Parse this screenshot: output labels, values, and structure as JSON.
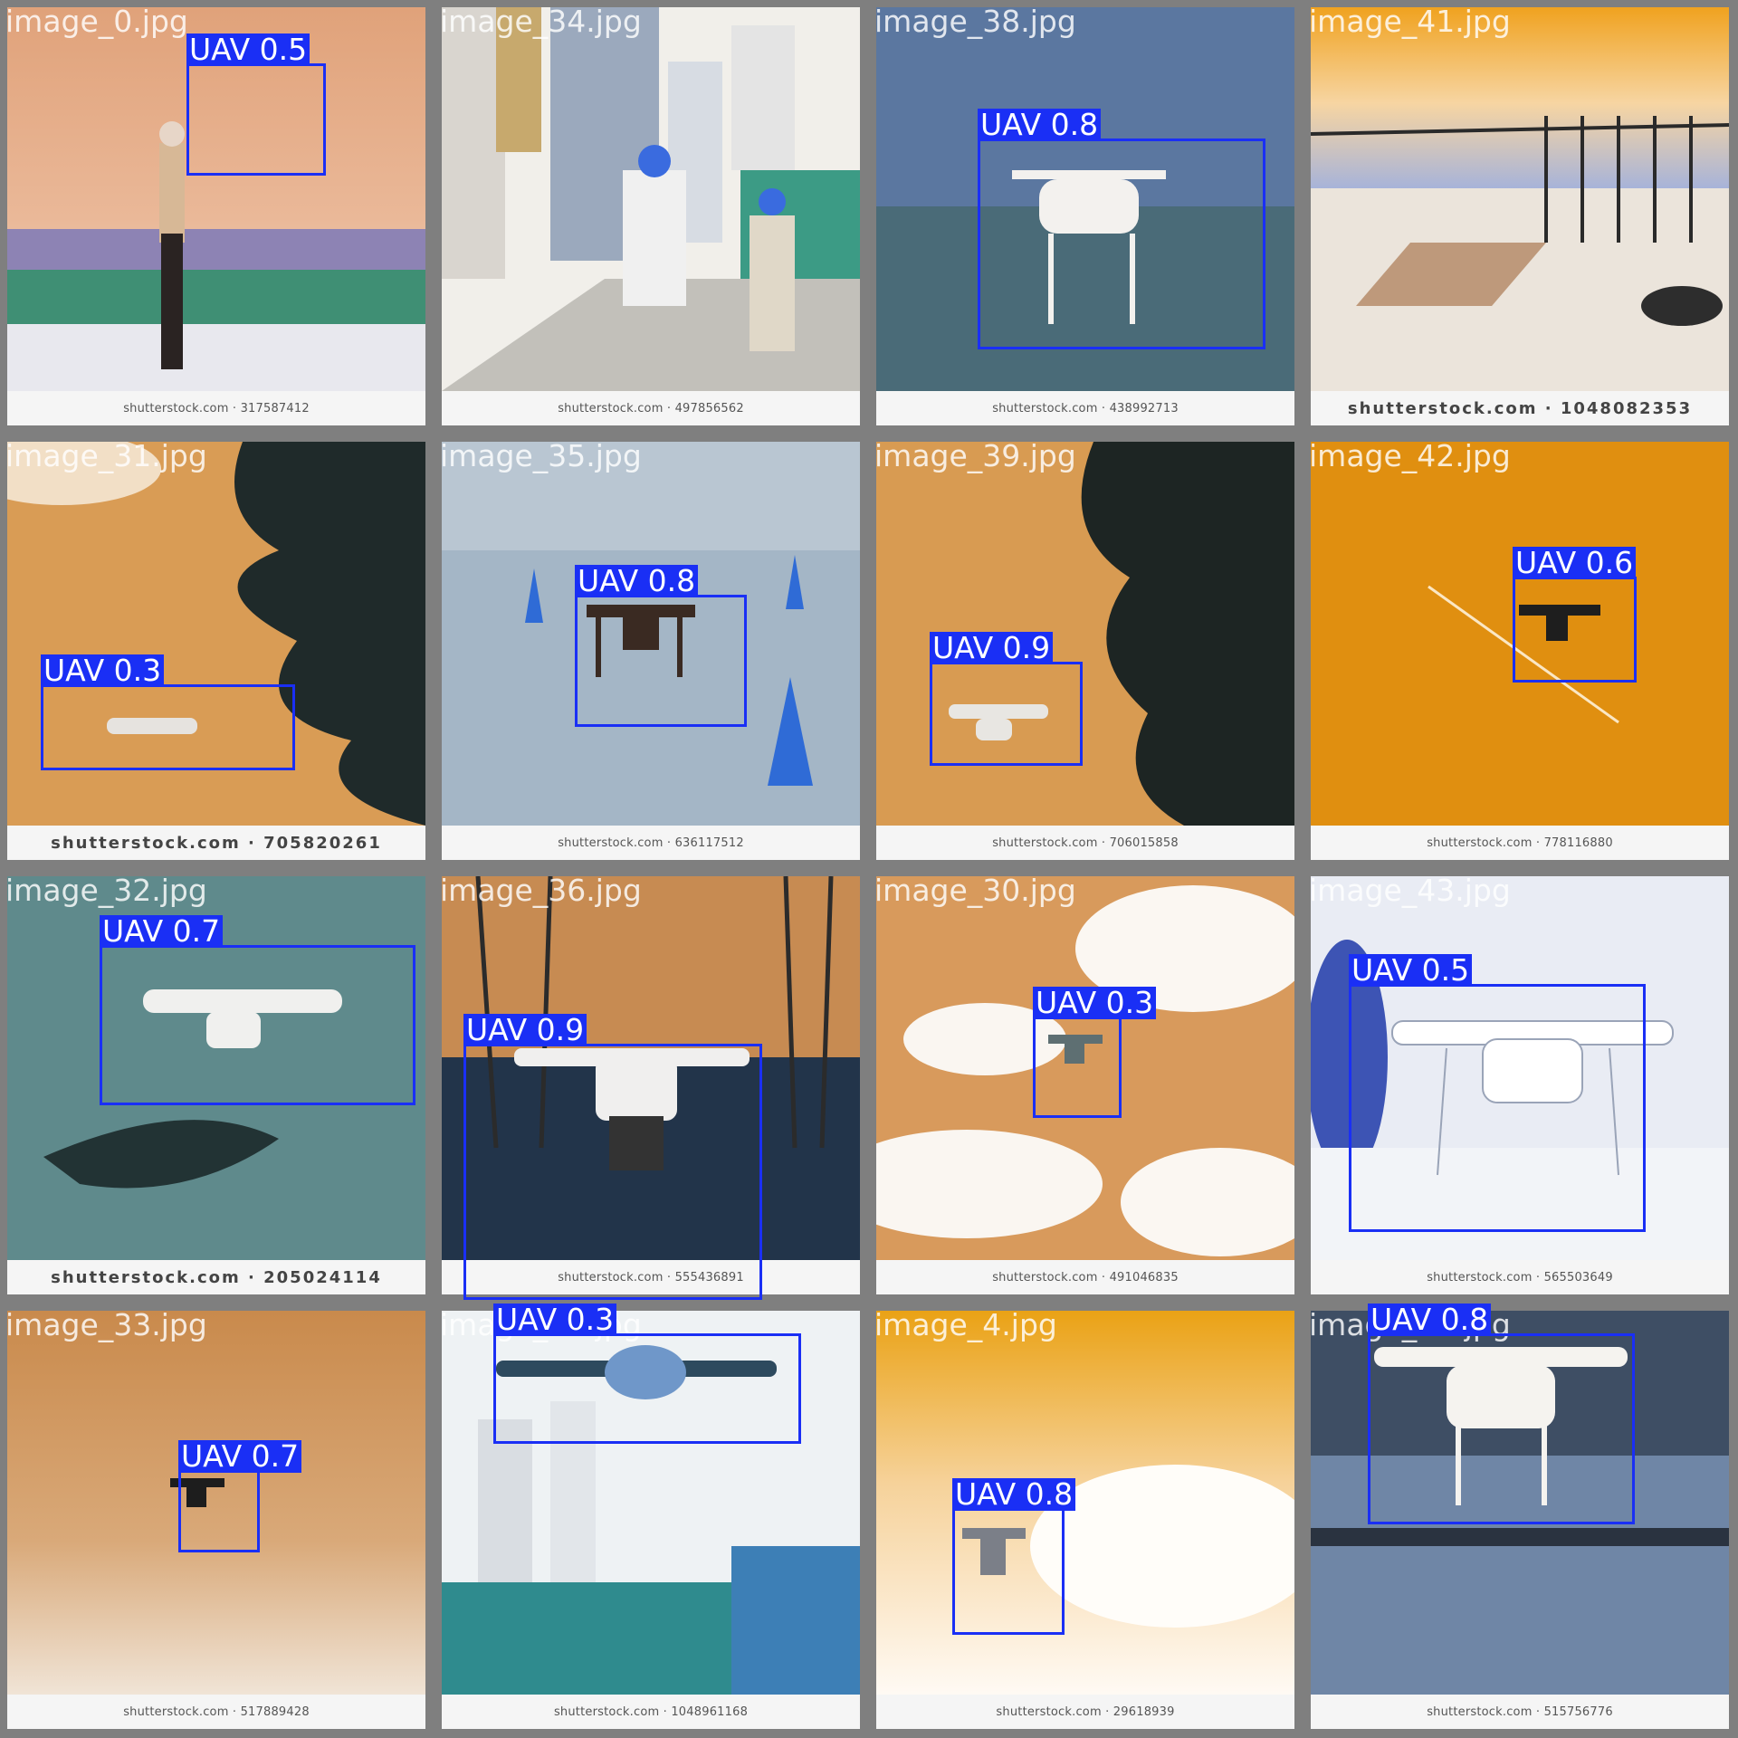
{
  "colors": {
    "box": "#1a2ff5",
    "grid_bg": "#7f7f7f"
  },
  "tiles": [
    {
      "filename": "image_0.jpg",
      "watermark": "shutterstock.com · 317587412",
      "det": "UAV 0.5"
    },
    {
      "filename": "image_34.jpg",
      "watermark": "shutterstock.com · 497856562",
      "det": ""
    },
    {
      "filename": "image_38.jpg",
      "watermark": "shutterstock.com · 438992713",
      "det": "UAV 0.8"
    },
    {
      "filename": "image_41.jpg",
      "watermark": "shutterstock.com · 1048082353",
      "det": ""
    },
    {
      "filename": "image_31.jpg",
      "watermark": "shutterstock.com · 705820261",
      "det": "UAV 0.3"
    },
    {
      "filename": "image_35.jpg",
      "watermark": "shutterstock.com · 636117512",
      "det": "UAV 0.8"
    },
    {
      "filename": "image_39.jpg",
      "watermark": "shutterstock.com · 706015858",
      "det": "UAV 0.9"
    },
    {
      "filename": "image_42.jpg",
      "watermark": "shutterstock.com · 778116880",
      "det": "UAV 0.6"
    },
    {
      "filename": "image_32.jpg",
      "watermark": "shutterstock.com · 205024114",
      "det": "UAV 0.7"
    },
    {
      "filename": "image_36.jpg",
      "watermark": "shutterstock.com · 555436891",
      "det": "UAV 0.9"
    },
    {
      "filename": "image_30.jpg",
      "watermark": "shutterstock.com · 491046835",
      "det": "UAV 0.3"
    },
    {
      "filename": "image_43.jpg",
      "watermark": "shutterstock.com · 565503649",
      "det": "UAV 0.5"
    },
    {
      "filename": "image_33.jpg",
      "watermark": "shutterstock.com · 517889428",
      "det": "UAV 0.7"
    },
    {
      "filename": "image_37.jpg",
      "watermark": "shutterstock.com · 1048961168",
      "det": "UAV 0.3"
    },
    {
      "filename": "image_4.jpg",
      "watermark": "shutterstock.com · 29618939",
      "det": "UAV 0.8"
    },
    {
      "filename": "image_44.jpg",
      "watermark": "shutterstock.com · 515756776",
      "det": "UAV 0.8"
    }
  ]
}
